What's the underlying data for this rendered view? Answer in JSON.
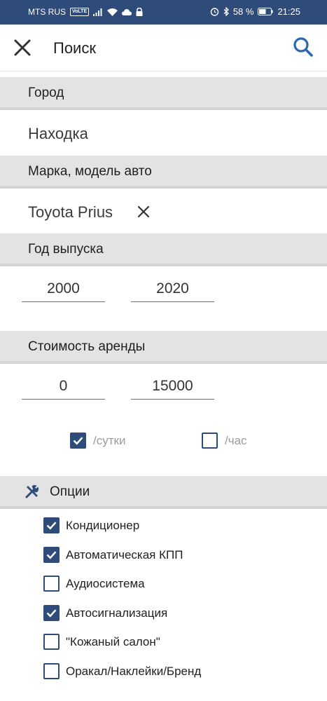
{
  "status_bar": {
    "carrier": "MTS RUS",
    "volte": "VoLTE",
    "battery": "58 %",
    "time": "21:25",
    "icons": [
      "signal-icon",
      "wifi-icon",
      "cloud-icon",
      "lock-icon",
      "alarm-icon",
      "bluetooth-icon",
      "battery-icon"
    ]
  },
  "app_bar": {
    "title": "Поиск",
    "close_icon": "close-icon",
    "search_icon": "search-icon",
    "accent_color": "#2f4b79"
  },
  "city": {
    "header": "Город",
    "value": "Находка"
  },
  "car": {
    "header": "Марка, модель авто",
    "value": "Toyota Prius"
  },
  "year": {
    "header": "Год выпуска",
    "from": "2000",
    "to": "2020"
  },
  "price": {
    "header": "Стоимость аренды",
    "from": "0",
    "to": "15000",
    "periods": [
      {
        "label": "/сутки",
        "checked": true
      },
      {
        "label": "/час",
        "checked": false
      }
    ]
  },
  "options": {
    "header": "Опции",
    "icon": "tools-icon",
    "items": [
      {
        "label": "Кондиционер",
        "checked": true
      },
      {
        "label": "Автоматическая КПП",
        "checked": true
      },
      {
        "label": "Аудиосистема",
        "checked": false
      },
      {
        "label": "Автосигнализация",
        "checked": true
      },
      {
        "label": "\"Кожаный салон\"",
        "checked": false
      },
      {
        "label": "Оракал/Наклейки/Бренд",
        "checked": false
      }
    ]
  }
}
